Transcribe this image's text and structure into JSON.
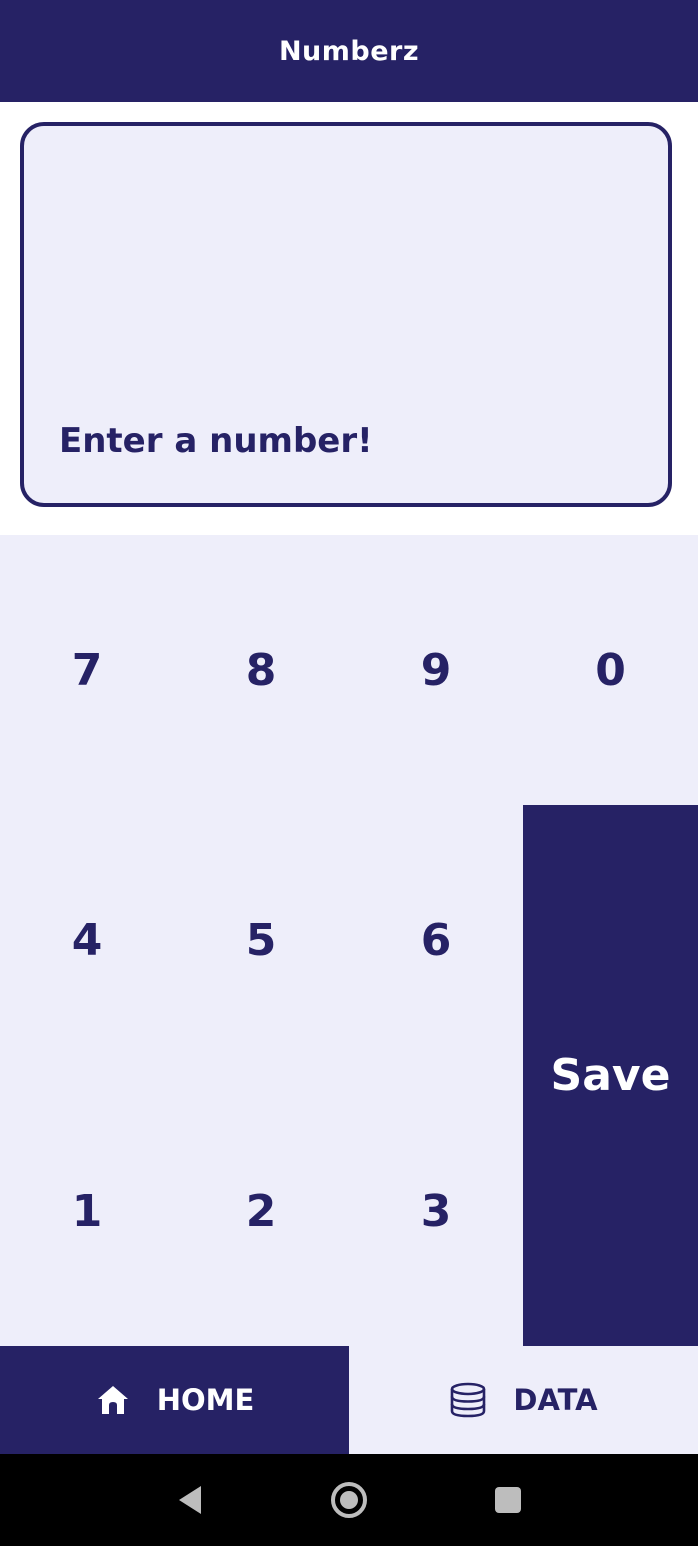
{
  "app": {
    "title": "Numberz"
  },
  "display": {
    "placeholder": "Enter a number!"
  },
  "keypad": {
    "rows": [
      [
        "7",
        "8",
        "9",
        "0"
      ],
      [
        "4",
        "5",
        "6"
      ],
      [
        "1",
        "2",
        "3"
      ]
    ],
    "save_label": "Save"
  },
  "nav": {
    "home_label": "HOME",
    "home_icon": "home-icon",
    "data_label": "DATA",
    "data_icon": "database-icon",
    "active": "HOME"
  },
  "system_nav": {
    "back_icon": "back-triangle-icon",
    "home_icon": "home-circle-icon",
    "recents_icon": "recents-square-icon"
  },
  "colors": {
    "primary": "#262265",
    "surface": "#eeeefa",
    "on_primary": "#ffffff"
  }
}
